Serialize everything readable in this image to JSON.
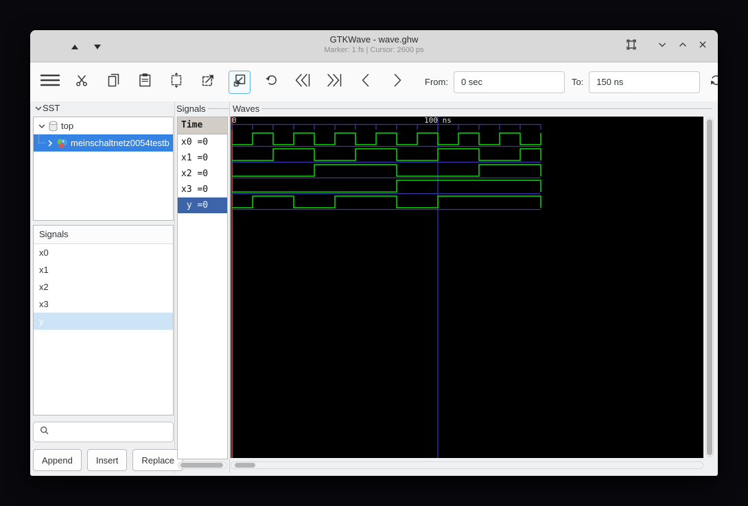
{
  "window": {
    "title": "GTKWave - wave.ghw",
    "subtitle": "Marker: 1 fs  |  Cursor: 2600 ps"
  },
  "toolbar": {
    "from_label": "From:",
    "from_value": "0 sec",
    "to_label": "To:",
    "to_value": "150 ns"
  },
  "sst": {
    "header": "SST",
    "items": [
      {
        "label": "top"
      },
      {
        "label": "meinschaltnetz0054testb"
      }
    ]
  },
  "signal_list": {
    "header": "Signals",
    "items": [
      {
        "label": "x0"
      },
      {
        "label": "x1"
      },
      {
        "label": "x2"
      },
      {
        "label": "x3"
      },
      {
        "label": "y"
      }
    ],
    "buttons": {
      "append": "Append",
      "insert": "Insert",
      "replace": "Replace"
    }
  },
  "wave_names": {
    "frame_label": "Signals",
    "time_header": "Time",
    "rows": [
      {
        "text": "x0 =0"
      },
      {
        "text": "x1 =0"
      },
      {
        "text": "x2 =0"
      },
      {
        "text": "x3 =0"
      },
      {
        "text": " y =0"
      }
    ]
  },
  "waves": {
    "frame_label": "Waves",
    "chart_data": {
      "type": "digital-waveform",
      "time_unit": "ns",
      "t_start": 0,
      "t_end": 150,
      "tick_interval": 10,
      "axis_labels": [
        {
          "t": 0,
          "text": "0"
        },
        {
          "t": 100,
          "text": "100 ns"
        }
      ],
      "marker_t": 0,
      "cursor_t": 100,
      "signals": [
        {
          "name": "x0",
          "initial": 0,
          "toggles": [
            10,
            20,
            30,
            40,
            50,
            60,
            70,
            80,
            90,
            100,
            110,
            120,
            130,
            140,
            150
          ]
        },
        {
          "name": "x1",
          "initial": 0,
          "toggles": [
            20,
            40,
            60,
            80,
            100,
            120,
            140
          ]
        },
        {
          "name": "x2",
          "initial": 0,
          "toggles": [
            40,
            80,
            120
          ]
        },
        {
          "name": "x3",
          "initial": 0,
          "toggles": [
            80
          ]
        },
        {
          "name": "y",
          "initial": 0,
          "toggles": [
            10,
            30,
            50,
            80,
            100
          ]
        }
      ],
      "colors": {
        "background": "#000000",
        "trace": "#00e000",
        "baseline": "#3a3aae",
        "cursor": "#3a3aae",
        "marker": "#cc5a5a",
        "tick_text": "#e0e0e0"
      }
    }
  }
}
